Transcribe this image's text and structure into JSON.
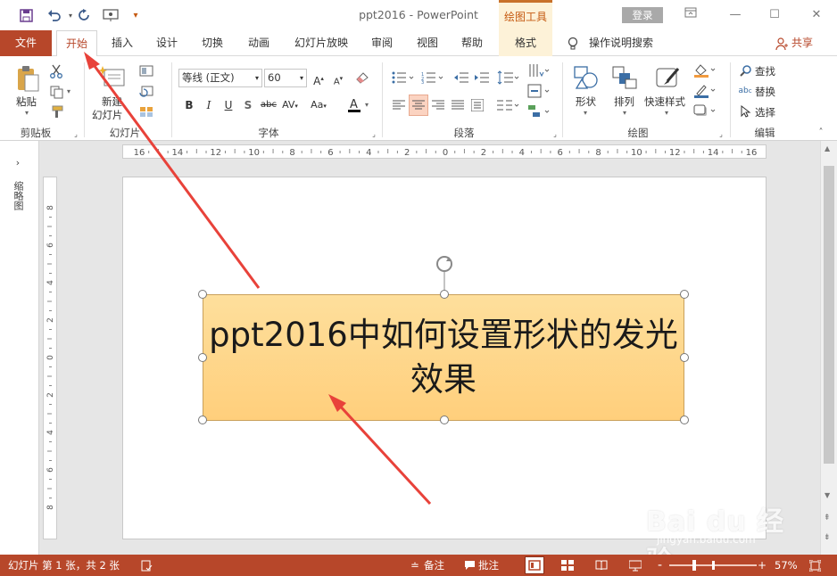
{
  "titlebar": {
    "doc_title": "ppt2016  -  PowerPoint",
    "contextual_tab": "绘图工具",
    "login": "登录"
  },
  "tabs": [
    "文件",
    "开始",
    "插入",
    "设计",
    "切换",
    "动画",
    "幻灯片放映",
    "审阅",
    "视图",
    "帮助",
    "格式"
  ],
  "tell_me": "操作说明搜索",
  "share": "共享",
  "ribbon": {
    "clipboard": {
      "paste": "粘贴",
      "label": "剪贴板"
    },
    "slides": {
      "new_slide_1": "新建",
      "new_slide_2": "幻灯片",
      "label": "幻灯片"
    },
    "font": {
      "font_name": "等线 (正文)",
      "font_size": "60",
      "label": "字体"
    },
    "paragraph": {
      "label": "段落"
    },
    "drawing": {
      "shapes": "形状",
      "arrange": "排列",
      "quick_styles": "快速样式",
      "label": "绘图"
    },
    "editing": {
      "find": "查找",
      "replace": "替换",
      "select": "选择",
      "label": "编辑"
    }
  },
  "thumbnail_pane": {
    "label": "缩略图"
  },
  "ruler": {
    "h_ticks": [
      "16",
      "14",
      "12",
      "10",
      "8",
      "6",
      "4",
      "2",
      "0",
      "2",
      "4",
      "6",
      "8",
      "10",
      "12",
      "14",
      "16"
    ],
    "v_ticks": [
      "8",
      "6",
      "4",
      "2",
      "0",
      "2",
      "4",
      "6",
      "8"
    ]
  },
  "slide": {
    "shape_text": "ppt2016中如何设置形状的发光效果"
  },
  "watermark": {
    "main": "Bai du 经验",
    "sub": "jingyan.baidu.com"
  },
  "statusbar": {
    "slide_info": "幻灯片 第 1 张，共 2 张",
    "notes": "备注",
    "comments": "批注",
    "zoom": "57%"
  },
  "colors": {
    "accent": "#b7472a",
    "shape_fill": "#ffd88f",
    "annotation_arrow": "#e8423a"
  }
}
